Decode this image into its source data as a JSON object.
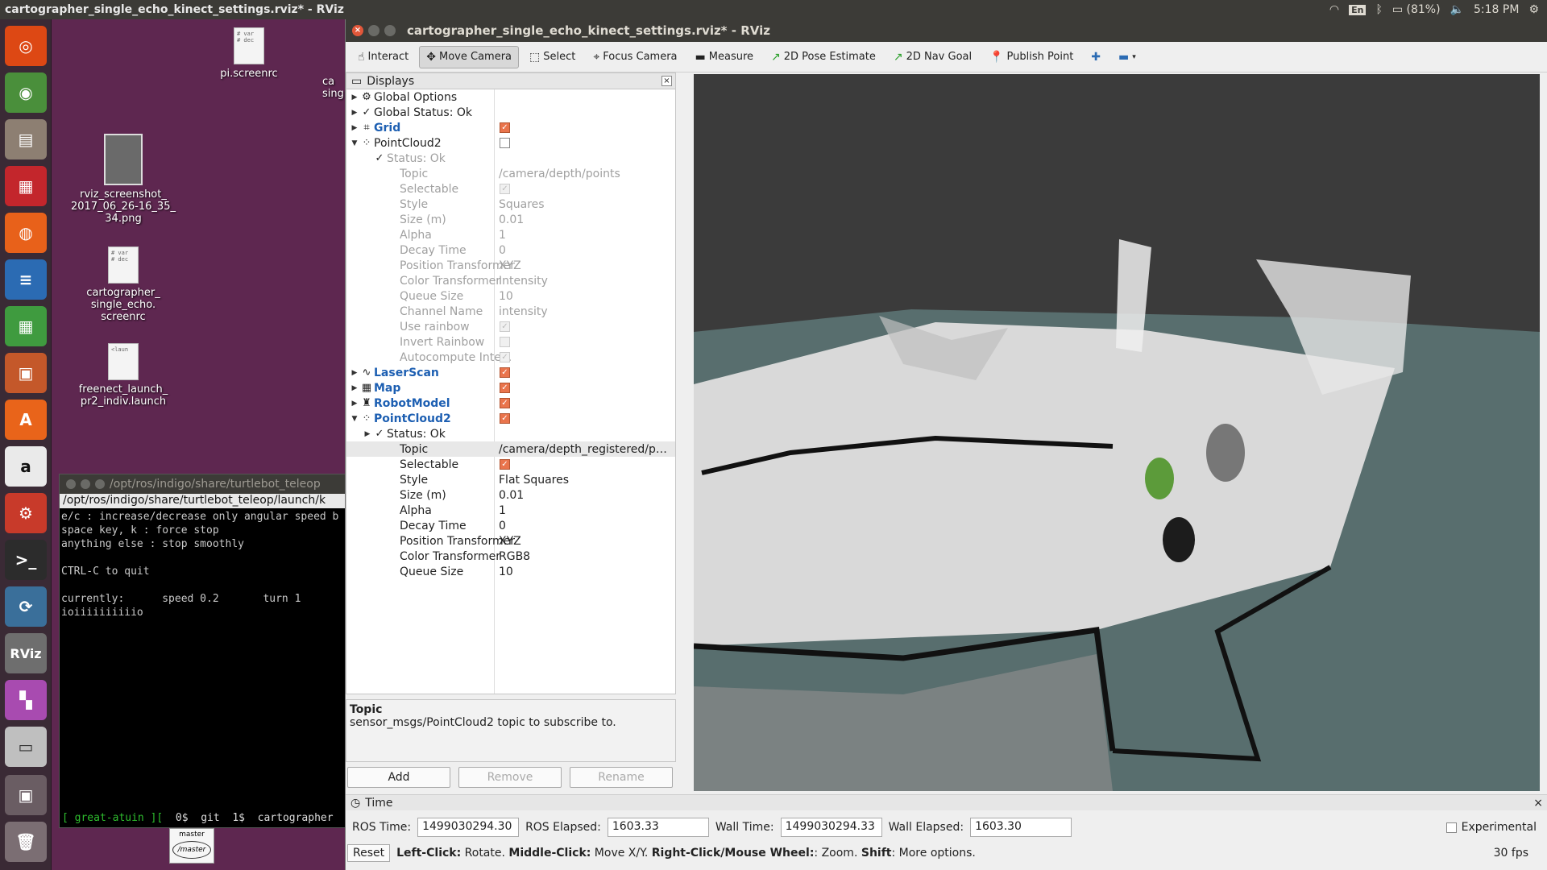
{
  "top_panel": {
    "title": "cartographer_single_echo_kinect_settings.rviz* - RViz",
    "lang": "En",
    "battery": "(81%)",
    "clock": "5:18 PM"
  },
  "desktop_icons": [
    {
      "label": "pi.screenrc",
      "file_text": "# var\n# dec"
    },
    {
      "label": "rviz_screenshot_\n2017_06_26-16_35_\n34.png"
    },
    {
      "label": "cartographer_\nsingle_echo.\nscreenrc",
      "file_text": "# var\n# dec"
    },
    {
      "label": "freenect_launch_\npr2_indiv.launch",
      "file_text": "<laun"
    }
  ],
  "desktop_fragments": {
    "a": "ca",
    "b": "sing"
  },
  "terminal": {
    "title": "/opt/ros/indigo/share/turtlebot_teleop",
    "tab": "/opt/ros/indigo/share/turtlebot_teleop/launch/k",
    "lines": "e/c : increase/decrease only angular speed b\nspace key, k : force stop\nanything else : stop smoothly\n\nCTRL-C to quit\n\ncurrently:      speed 0.2       turn 1\nioiiiiiiiiiio",
    "status_host": "[ great-atuin ][",
    "status_rest": "  0$  git  1$  cartographer"
  },
  "master_icon": {
    "top": "master",
    "ring": "/master"
  },
  "rviz": {
    "title": "cartographer_single_echo_kinect_settings.rviz* - RViz",
    "toolbar": [
      "Interact",
      "Move Camera",
      "Select",
      "Focus Camera",
      "Measure",
      "2D Pose Estimate",
      "2D Nav Goal",
      "Publish Point"
    ],
    "displays_title": "Displays",
    "tree": [
      {
        "label": "Global Options",
        "arrow": "▶",
        "icon": "⚙"
      },
      {
        "label": "Global Status: Ok",
        "arrow": "▶",
        "icon": "✓"
      },
      {
        "label": "Grid",
        "arrow": "▶",
        "icon": "⌗",
        "bold": true,
        "check": "on"
      },
      {
        "label": "PointCloud2",
        "arrow": "▼",
        "icon": "⁘",
        "check": "off"
      },
      {
        "label": "Status: Ok",
        "indent": 1,
        "icon": "✓",
        "dim": true
      },
      {
        "label": "Topic",
        "value": "/camera/depth/points",
        "dim": true,
        "indent": 2
      },
      {
        "label": "Selectable",
        "dim": true,
        "indent": 2,
        "check": "dim"
      },
      {
        "label": "Style",
        "value": "Squares",
        "dim": true,
        "indent": 2
      },
      {
        "label": "Size (m)",
        "value": "0.01",
        "dim": true,
        "indent": 2
      },
      {
        "label": "Alpha",
        "value": "1",
        "dim": true,
        "indent": 2
      },
      {
        "label": "Decay Time",
        "value": "0",
        "dim": true,
        "indent": 2
      },
      {
        "label": "Position Transformer",
        "value": "XYZ",
        "dim": true,
        "indent": 2
      },
      {
        "label": "Color Transformer",
        "value": "Intensity",
        "dim": true,
        "indent": 2
      },
      {
        "label": "Queue Size",
        "value": "10",
        "dim": true,
        "indent": 2
      },
      {
        "label": "Channel Name",
        "value": "intensity",
        "dim": true,
        "indent": 2
      },
      {
        "label": "Use rainbow",
        "dim": true,
        "indent": 2,
        "check": "dim"
      },
      {
        "label": "Invert Rainbow",
        "dim": true,
        "indent": 2,
        "check": "dimoff"
      },
      {
        "label": "Autocompute Inte...",
        "dim": true,
        "indent": 2,
        "check": "dim"
      },
      {
        "label": "LaserScan",
        "arrow": "▶",
        "icon": "∿",
        "bold": true,
        "check": "on"
      },
      {
        "label": "Map",
        "arrow": "▶",
        "icon": "▦",
        "bold": true,
        "check": "on"
      },
      {
        "label": "RobotModel",
        "arrow": "▶",
        "icon": "♜",
        "bold": true,
        "check": "on"
      },
      {
        "label": "PointCloud2",
        "arrow": "▼",
        "icon": "⁘",
        "bold": true,
        "check": "on"
      },
      {
        "label": "Status: Ok",
        "indent": 1,
        "arrow": "▶",
        "icon": "✓"
      },
      {
        "label": "Topic",
        "value": "/camera/depth_registered/po...",
        "indent": 2,
        "selected": true
      },
      {
        "label": "Selectable",
        "indent": 2,
        "check": "on"
      },
      {
        "label": "Style",
        "value": "Flat Squares",
        "indent": 2
      },
      {
        "label": "Size (m)",
        "value": "0.01",
        "indent": 2
      },
      {
        "label": "Alpha",
        "value": "1",
        "indent": 2
      },
      {
        "label": "Decay Time",
        "value": "0",
        "indent": 2
      },
      {
        "label": "Position Transformer",
        "value": "XYZ",
        "indent": 2
      },
      {
        "label": "Color Transformer",
        "value": "RGB8",
        "indent": 2
      },
      {
        "label": "Queue Size",
        "value": "10",
        "indent": 2
      }
    ],
    "desc_title": "Topic",
    "desc_text": "sensor_msgs/PointCloud2 topic to subscribe to.",
    "buttons": {
      "add": "Add",
      "remove": "Remove",
      "rename": "Rename"
    },
    "time_panel": "Time",
    "time": {
      "ros_time_label": "ROS Time:",
      "ros_time": "1499030294.30",
      "ros_elapsed_label": "ROS Elapsed:",
      "ros_elapsed": "1603.33",
      "wall_time_label": "Wall Time:",
      "wall_time": "1499030294.33",
      "wall_elapsed_label": "Wall Elapsed:",
      "wall_elapsed": "1603.30",
      "experimental": "Experimental"
    },
    "status": {
      "reset": "Reset",
      "b1": "Left-Click:",
      "t1": " Rotate. ",
      "b2": "Middle-Click:",
      "t2": " Move X/Y. ",
      "b3": "Right-Click/Mouse Wheel:",
      "t3": ": Zoom. ",
      "b4": "Shift",
      "t4": ": More options.",
      "fps": "30 fps"
    }
  }
}
